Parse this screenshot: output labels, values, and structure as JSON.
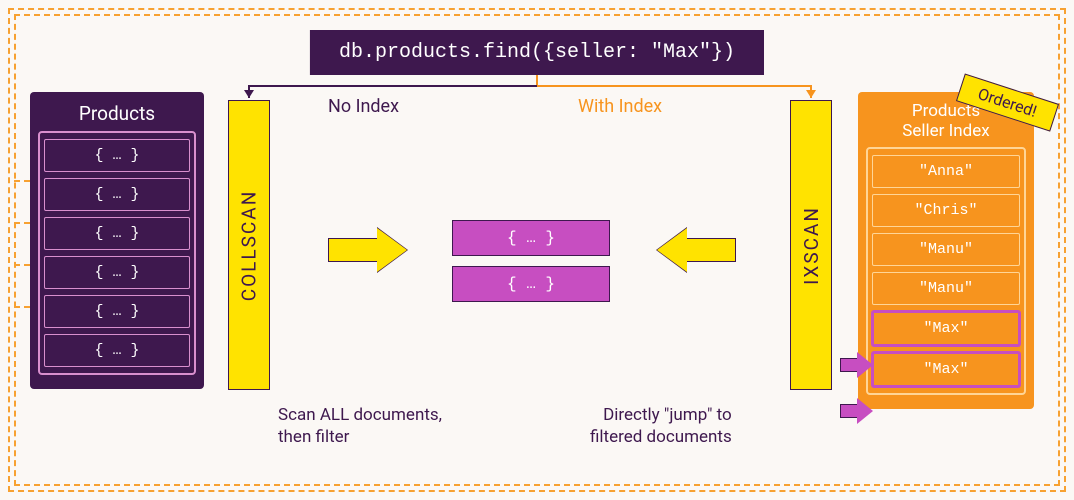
{
  "query": "db.products.find({seller: \"Max\"})",
  "labels": {
    "no_index": "No Index",
    "with_index": "With Index"
  },
  "products": {
    "title": "Products",
    "rows": [
      "{ … }",
      "{ … }",
      "{ … }",
      "{ … }",
      "{ … }",
      "{ … }"
    ]
  },
  "collscan": "COLLSCAN",
  "ixscan": "IXSCAN",
  "results": [
    "{ … }",
    "{ … }"
  ],
  "captions": {
    "scan_line1": "Scan ALL documents,",
    "scan_line2": "then filter",
    "jump_line1": "Directly \"jump\" to",
    "jump_line2": "filtered documents"
  },
  "index": {
    "title_line1": "Products",
    "title_line2": "Seller Index",
    "rows": [
      {
        "v": "\"Anna\"",
        "hl": false
      },
      {
        "v": "\"Chris\"",
        "hl": false
      },
      {
        "v": "\"Manu\"",
        "hl": false
      },
      {
        "v": "\"Manu\"",
        "hl": false
      },
      {
        "v": "\"Max\"",
        "hl": true
      },
      {
        "v": "\"Max\"",
        "hl": true
      }
    ]
  },
  "ordered_tag": "Ordered!"
}
